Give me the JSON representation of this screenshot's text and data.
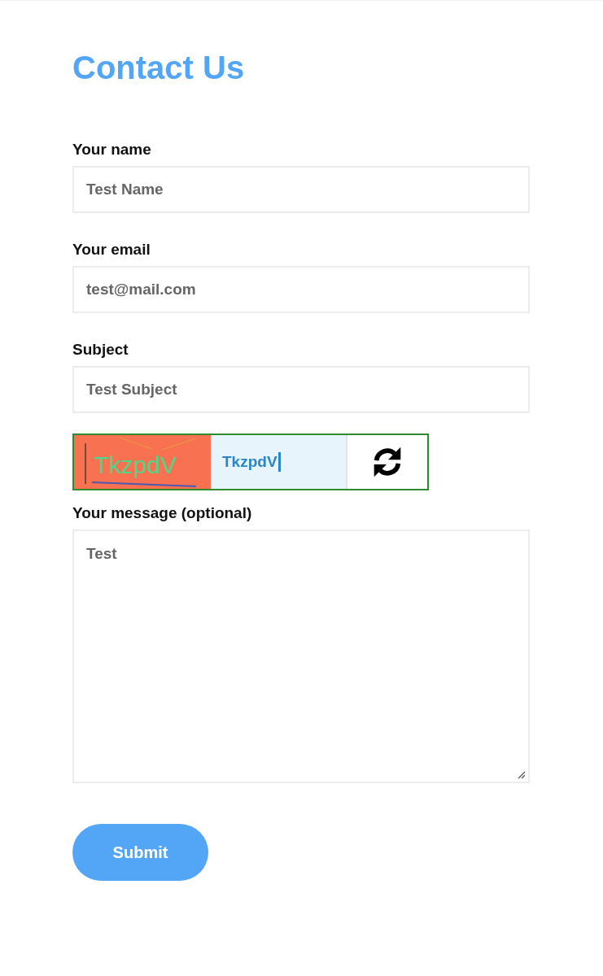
{
  "page": {
    "title": "Contact Us"
  },
  "fields": [
    {
      "kind": "input",
      "label": "Your name",
      "value": "Test Name"
    },
    {
      "kind": "input",
      "label": "Your email",
      "value": "test@mail.com"
    },
    {
      "kind": "input",
      "label": "Subject",
      "value": "Test Subject"
    },
    {
      "kind": "captcha",
      "image_text": "TkzpdV",
      "value": "TkzpdV",
      "valid": true,
      "focused": true
    },
    {
      "kind": "textarea",
      "label": "Your message (optional)",
      "value": "Test"
    }
  ],
  "submit": {
    "label": "Submit"
  }
}
